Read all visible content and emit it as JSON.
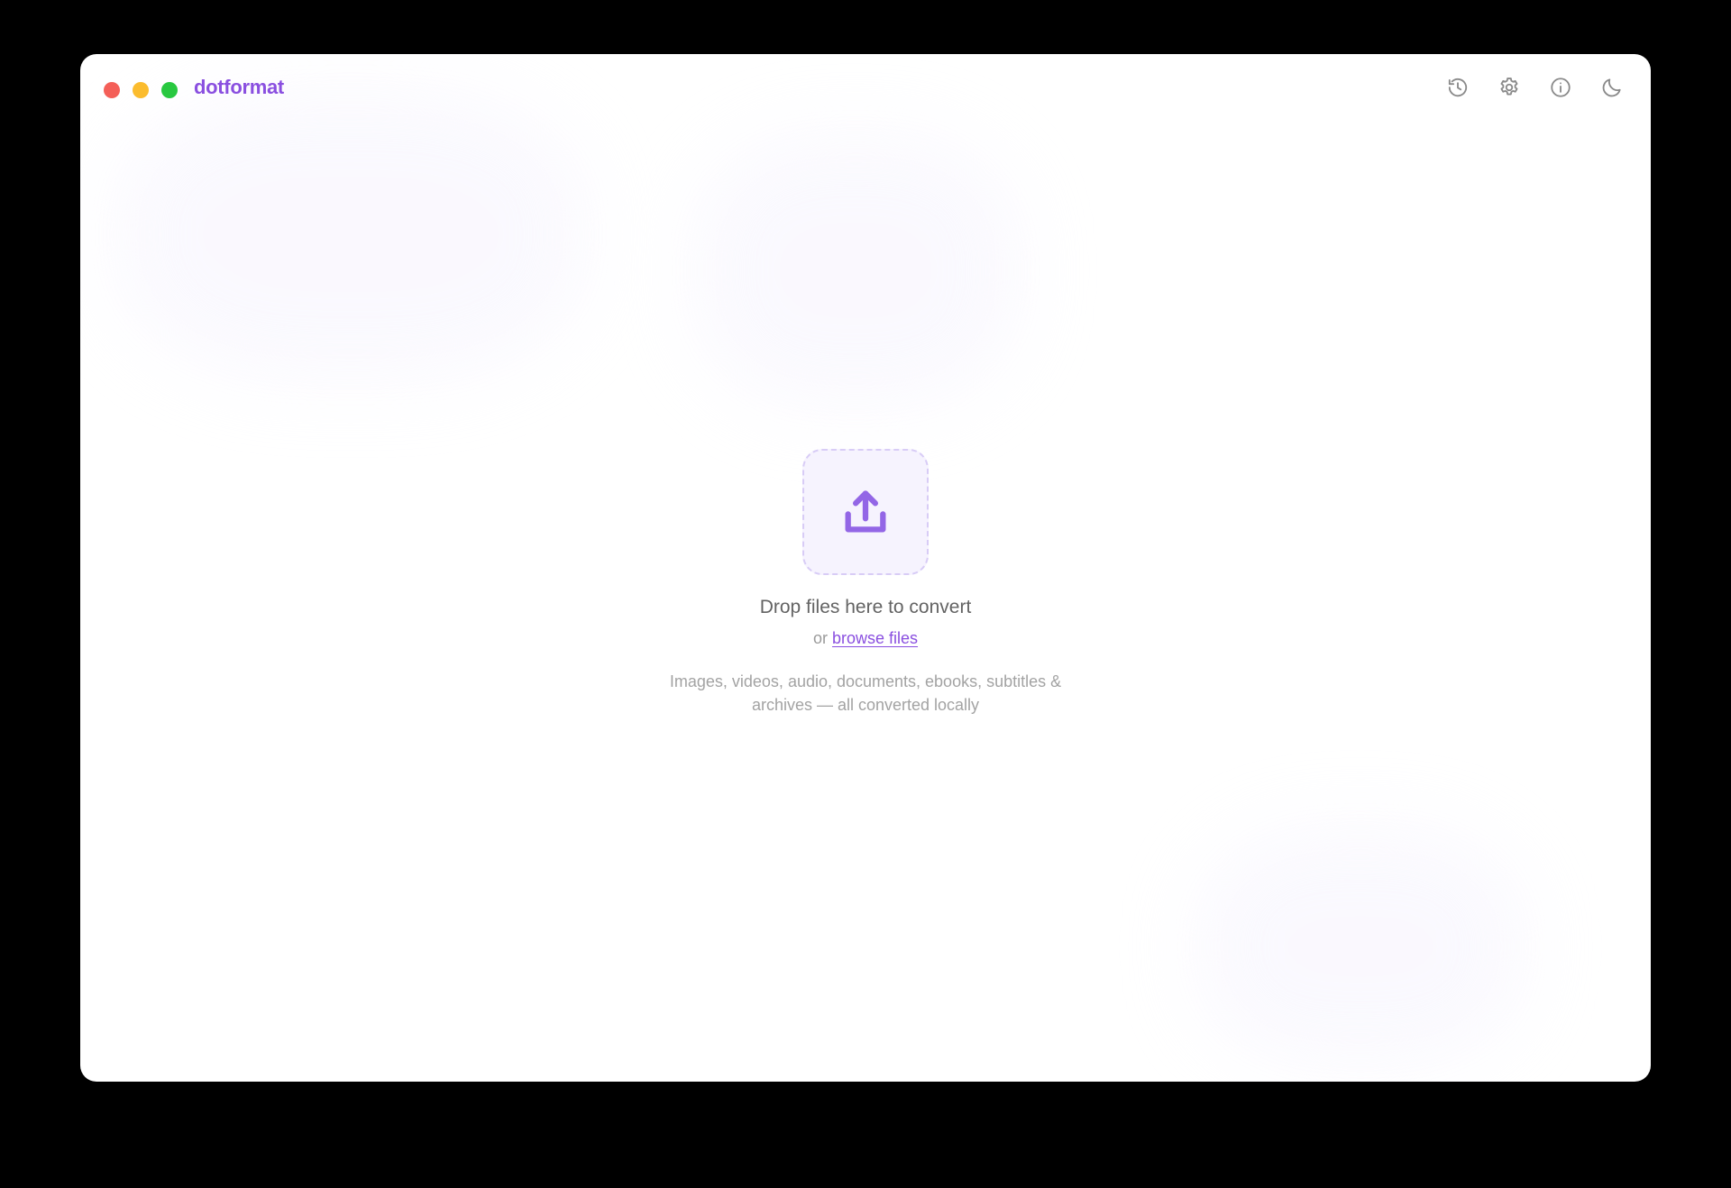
{
  "app": {
    "name": "dotformat",
    "accent_color": "#8a4fe0"
  },
  "window_controls": {
    "close_color": "#f45f58",
    "minimize_color": "#fbbc2e",
    "zoom_color": "#28c840"
  },
  "toolbar": {
    "icons": [
      "history-icon",
      "gear-icon",
      "info-icon",
      "moon-icon"
    ]
  },
  "dropzone": {
    "icon": "upload-icon",
    "title": "Drop files here to convert",
    "or_text": "or",
    "browse_label": "browse files",
    "description": "Images, videos, audio, documents, ebooks, subtitles & archives — all converted locally"
  }
}
